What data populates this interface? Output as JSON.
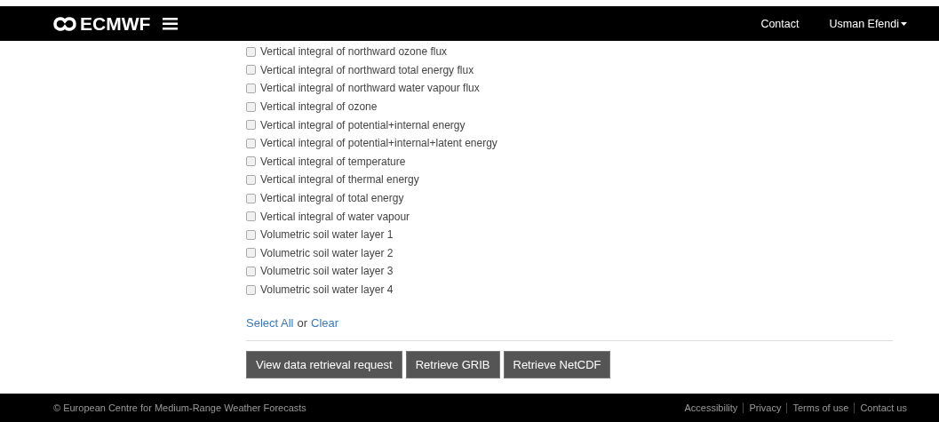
{
  "header": {
    "logo": "ECMWF",
    "nav": [
      {
        "label": "Contact"
      },
      {
        "label": "Usman Efendi",
        "dropdown": true
      }
    ]
  },
  "parameters": [
    {
      "label": "Vertical integral of northward ozone flux",
      "checked": false
    },
    {
      "label": "Vertical integral of northward total energy flux",
      "checked": false
    },
    {
      "label": "Vertical integral of northward water vapour flux",
      "checked": false
    },
    {
      "label": "Vertical integral of ozone",
      "checked": false
    },
    {
      "label": "Vertical integral of potential+internal energy",
      "checked": false
    },
    {
      "label": "Vertical integral of potential+internal+latent energy",
      "checked": false
    },
    {
      "label": "Vertical integral of temperature",
      "checked": false
    },
    {
      "label": "Vertical integral of thermal energy",
      "checked": false
    },
    {
      "label": "Vertical integral of total energy",
      "checked": false
    },
    {
      "label": "Vertical integral of water vapour",
      "checked": false
    },
    {
      "label": "Volumetric soil water layer 1",
      "checked": false
    },
    {
      "label": "Volumetric soil water layer 2",
      "checked": false
    },
    {
      "label": "Volumetric soil water layer 3",
      "checked": false
    },
    {
      "label": "Volumetric soil water layer 4",
      "checked": false
    }
  ],
  "selection": {
    "select_all": "Select All",
    "or": "or",
    "clear": "Clear"
  },
  "buttons": [
    "View data retrieval request",
    "Retrieve GRIB",
    "Retrieve NetCDF"
  ],
  "footer": {
    "copyright": "© European Centre for Medium-Range Weather Forecasts",
    "links": [
      "Accessibility",
      "Privacy",
      "Terms of use",
      "Contact us"
    ]
  }
}
